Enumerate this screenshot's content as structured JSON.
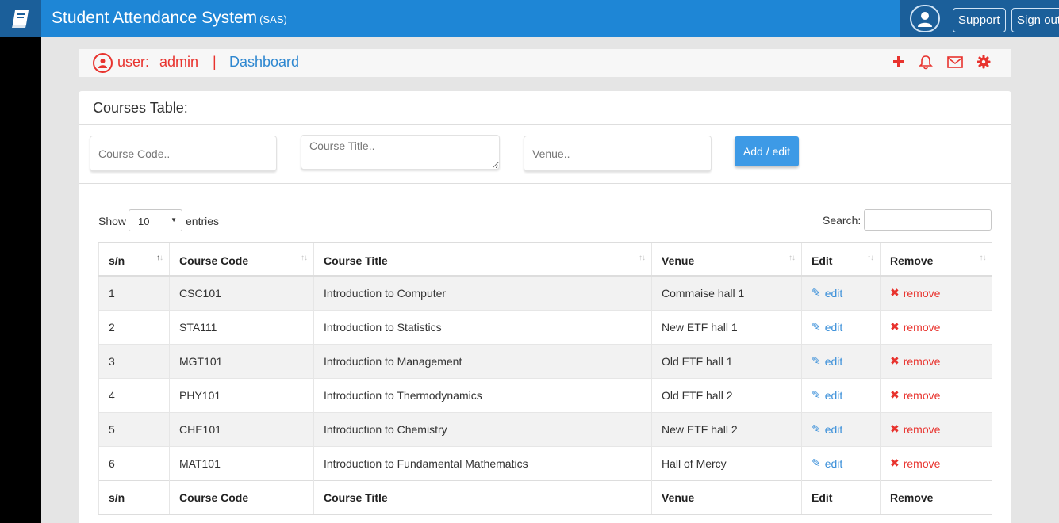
{
  "header": {
    "title": "Student Attendance System",
    "subtitle": "(SAS)",
    "support_label": "Support",
    "signout_label": "Sign out"
  },
  "userbar": {
    "user_label": "user:",
    "username": "admin",
    "separator": "|",
    "dashboard_label": "Dashboard"
  },
  "card": {
    "title": "Courses Table:"
  },
  "form": {
    "course_code_placeholder": "Course Code..",
    "course_title_placeholder": "Course Title..",
    "venue_placeholder": "Venue..",
    "submit_label": "Add / edit"
  },
  "table_controls": {
    "show_label": "Show",
    "entries_value": "10",
    "entries_label": "entries",
    "search_label": "Search:"
  },
  "table": {
    "columns": [
      "s/n",
      "Course Code",
      "Course Title",
      "Venue",
      "Edit",
      "Remove"
    ],
    "rows": [
      {
        "sn": "1",
        "code": "CSC101",
        "title": "Introduction to Computer",
        "venue": "Commaise hall 1",
        "edit": "edit",
        "remove": "remove"
      },
      {
        "sn": "2",
        "code": "STA111",
        "title": "Introduction to Statistics",
        "venue": "New ETF hall 1",
        "edit": "edit",
        "remove": "remove"
      },
      {
        "sn": "3",
        "code": "MGT101",
        "title": "Introduction to Management",
        "venue": "Old ETF hall 1",
        "edit": "edit",
        "remove": "remove"
      },
      {
        "sn": "4",
        "code": "PHY101",
        "title": "Introduction to Thermodynamics",
        "venue": "Old ETF hall 2",
        "edit": "edit",
        "remove": "remove"
      },
      {
        "sn": "5",
        "code": "CHE101",
        "title": "Introduction to Chemistry",
        "venue": "New ETF hall 2",
        "edit": "edit",
        "remove": "remove"
      },
      {
        "sn": "6",
        "code": "MAT101",
        "title": "Introduction to Fundamental Mathematics",
        "venue": "Hall of Mercy",
        "edit": "edit",
        "remove": "remove"
      }
    ]
  },
  "colors": {
    "topbar": "#1e86d6",
    "topbar_dark": "#1b5f9a",
    "accent_red": "#e8332e",
    "link_blue": "#2e87d0",
    "button_blue": "#3d9ae6"
  },
  "icons": {
    "brand": "book-icon",
    "avatar": "user-avatar-icon",
    "user": "user-circle-icon",
    "add": "plus-icon",
    "notifications": "bell-icon",
    "messages": "envelope-icon",
    "settings": "gear-icon",
    "edit": "edit-icon",
    "remove": "times-icon"
  }
}
